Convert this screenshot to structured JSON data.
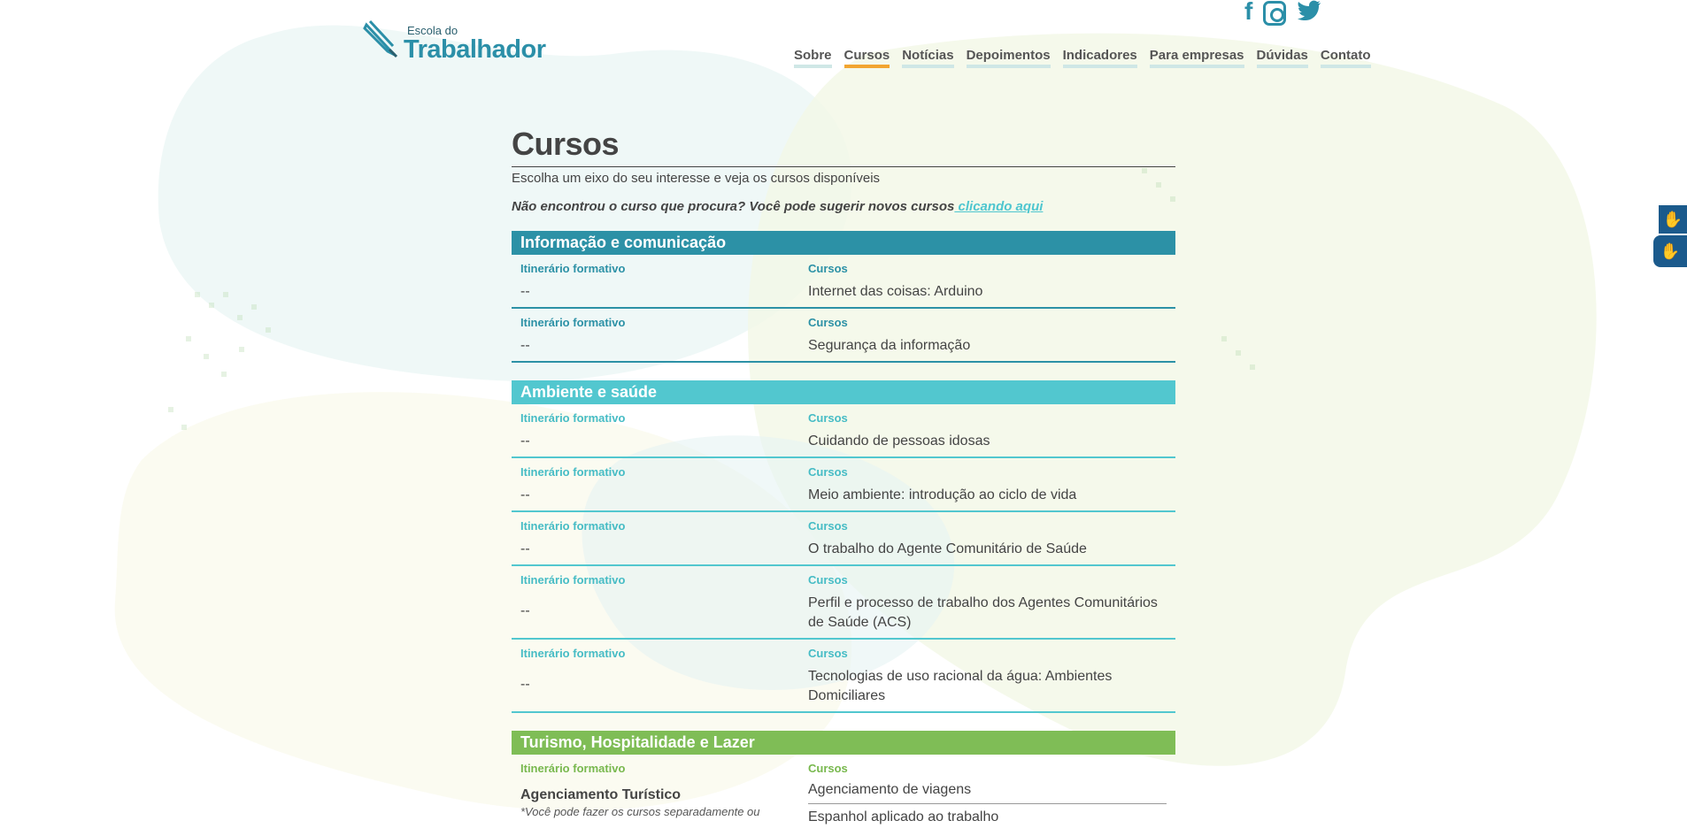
{
  "header": {
    "logo_small": "Escola do",
    "logo_big": "Trabalhador",
    "social": [
      "facebook-icon",
      "instagram-icon",
      "twitter-icon"
    ],
    "nav": [
      {
        "label": "Sobre",
        "active": false
      },
      {
        "label": "Cursos",
        "active": true
      },
      {
        "label": "Notícias",
        "active": false
      },
      {
        "label": "Depoimentos",
        "active": false
      },
      {
        "label": "Indicadores",
        "active": false
      },
      {
        "label": "Para empresas",
        "active": false
      },
      {
        "label": "Dúvidas",
        "active": false
      },
      {
        "label": "Contato",
        "active": false
      }
    ]
  },
  "page": {
    "title": "Cursos",
    "subtitle": "Escolha um eixo do seu interesse e veja os cursos disponíveis",
    "suggest_text": "Não encontrou o curso que procura? Você pode sugerir novos cursos",
    "suggest_link": " clicando aqui"
  },
  "labels": {
    "itinerary": "Itinerário formativo",
    "courses": "Cursos"
  },
  "groups": [
    {
      "title": "Informação e comunicação",
      "color": "#2c91a6",
      "rows": [
        {
          "itinerary": "--",
          "course": "Internet das coisas: Arduino"
        },
        {
          "itinerary": "--",
          "course": "Segurança da informação"
        }
      ]
    },
    {
      "title": "Ambiente e saúde",
      "color": "#52c7cf",
      "rows": [
        {
          "itinerary": "--",
          "course": "Cuidando de pessoas idosas"
        },
        {
          "itinerary": "--",
          "course": "Meio ambiente: introdução ao ciclo de vida"
        },
        {
          "itinerary": "--",
          "course": "O trabalho do Agente Comunitário de Saúde"
        },
        {
          "itinerary": "--",
          "course": "Perfil e processo de trabalho dos Agentes Comunitários de Saúde (ACS)"
        },
        {
          "itinerary": "--",
          "course": "Tecnologias de uso racional da água: Ambientes Domiciliares"
        }
      ]
    },
    {
      "title": "Turismo, Hospitalidade e Lazer",
      "color": "#7fbd56",
      "rows": [
        {
          "itinerary": "Agenciamento Turístico",
          "itinerary_note": "*Você pode fazer os cursos separadamente ou",
          "courses": [
            "Agenciamento de viagens",
            "Espanhol aplicado ao trabalho"
          ]
        }
      ]
    }
  ],
  "accessibility": [
    "sign-language-icon",
    "sign-language-icon"
  ]
}
